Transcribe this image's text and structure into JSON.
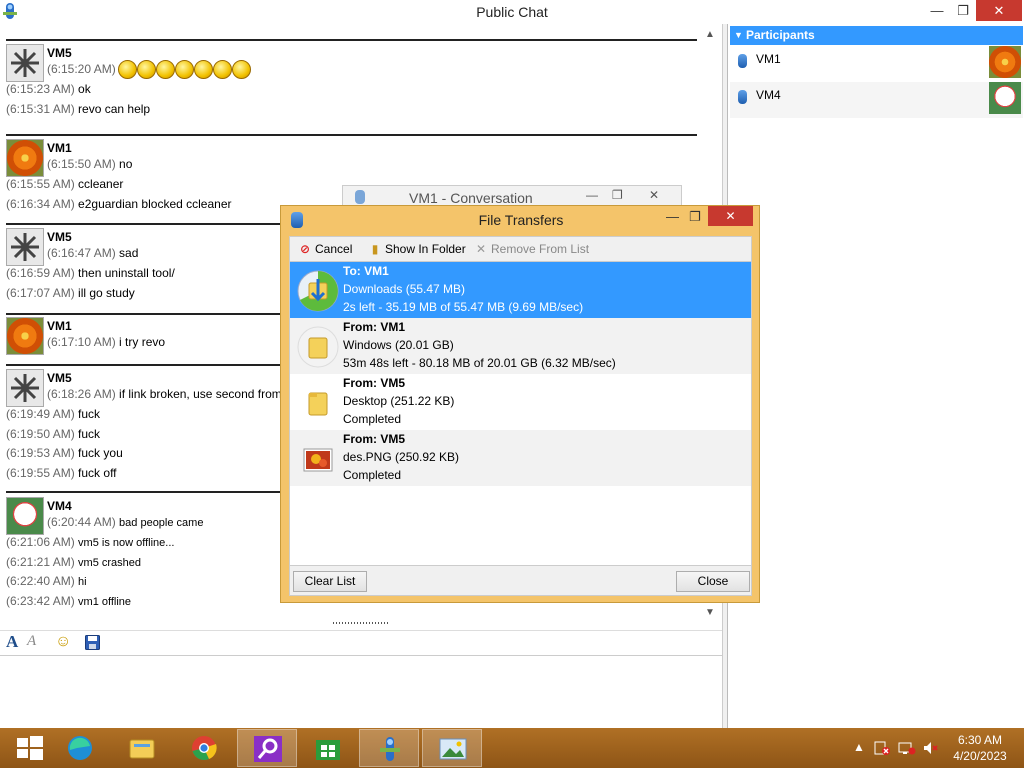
{
  "window": {
    "title": "Public Chat",
    "minimize": "—",
    "maximize": "❐",
    "close": "✕"
  },
  "chat": {
    "blocks": [
      {
        "user": "VM5",
        "avatar": "vm5",
        "messages": [
          {
            "time": "(6:15:20 AM)",
            "text": ""
          },
          {
            "time": "(6:15:23 AM)",
            "text": "ok"
          },
          {
            "time": "(6:15:31 AM)",
            "text": "revo can help"
          }
        ]
      },
      {
        "user": "VM1",
        "avatar": "vm1",
        "messages": [
          {
            "time": "(6:15:50 AM)",
            "text": "no"
          },
          {
            "time": "(6:15:55 AM)",
            "text": "ccleaner"
          },
          {
            "time": "(6:16:34 AM)",
            "text": "e2guardian blocked ccleaner"
          }
        ]
      },
      {
        "user": "VM5",
        "avatar": "vm5",
        "messages": [
          {
            "time": "(6:16:47 AM)",
            "text": "sad"
          },
          {
            "time": "(6:16:59 AM)",
            "text": "then uninstall tool/"
          },
          {
            "time": "(6:17:07 AM)",
            "text": "ill go study"
          }
        ]
      },
      {
        "user": "VM1",
        "avatar": "vm1",
        "messages": [
          {
            "time": "(6:17:10 AM)",
            "text": "i try revo"
          }
        ]
      },
      {
        "user": "VM5",
        "avatar": "vm5",
        "messages": [
          {
            "time": "(6:18:26 AM)",
            "text": "if link broken, use second from"
          },
          {
            "time": "(6:19:49 AM)",
            "text": "fuck"
          },
          {
            "time": "(6:19:50 AM)",
            "text": "fuck"
          },
          {
            "time": "(6:19:53 AM)",
            "text": "fuck you"
          },
          {
            "time": "(6:19:55 AM)",
            "text": "fuck off"
          }
        ]
      },
      {
        "user": "VM4",
        "avatar": "vm4",
        "messages": [
          {
            "time": "(6:20:44 AM)",
            "text": "bad people came"
          },
          {
            "time": "(6:21:06 AM)",
            "text": "vm5 is now offline..."
          },
          {
            "time": "(6:21:21 AM)",
            "text": "vm5 crashed"
          },
          {
            "time": "(6:22:40 AM)",
            "text": "hi"
          },
          {
            "time": "(6:23:42 AM)",
            "text": "vm1 offline"
          }
        ]
      }
    ],
    "emoticon_count": 7
  },
  "compose_toolbar": {
    "font_icon": "A",
    "font_color_icon": "A",
    "emoticon_icon": "☺",
    "save_icon": "💾"
  },
  "participants": {
    "header": "Participants",
    "items": [
      {
        "name": "VM1",
        "avatar": "vm1"
      },
      {
        "name": "VM4",
        "avatar": "vm4"
      }
    ]
  },
  "conversation_window": {
    "title": "VM1 - Conversation"
  },
  "file_transfers": {
    "title": "File Transfers",
    "toolbar": {
      "cancel": "Cancel",
      "show_in_folder": "Show In Folder",
      "remove_from_list": "Remove From List"
    },
    "items": [
      {
        "who": "To: VM1",
        "name": "Downloads (55.47 MB)",
        "status": "2s left - 35.19 MB of 55.47 MB (9.69 MB/sec)",
        "selected": true,
        "progress": 0.63
      },
      {
        "who": "From: VM1",
        "name": "Windows (20.01 GB)",
        "status": "53m 48s left - 80.18 MB of 20.01 GB (6.32 MB/sec)",
        "selected": false,
        "progress": 0.004
      },
      {
        "who": "From: VM5",
        "name": "Desktop (251.22 KB)",
        "status": "Completed",
        "selected": false,
        "progress": 1
      },
      {
        "who": "From: VM5",
        "name": "des.PNG (250.92 KB)",
        "status": "Completed",
        "selected": false,
        "progress": 1
      }
    ],
    "clear_list": "Clear List",
    "close": "Close"
  },
  "taskbar": {
    "apps": [
      "windows-start",
      "edge",
      "file-explorer",
      "chrome",
      "search",
      "store",
      "chat-app",
      "image-viewer"
    ],
    "active_app": "chat-app",
    "time": "6:30 AM",
    "date": "4/20/2023"
  }
}
